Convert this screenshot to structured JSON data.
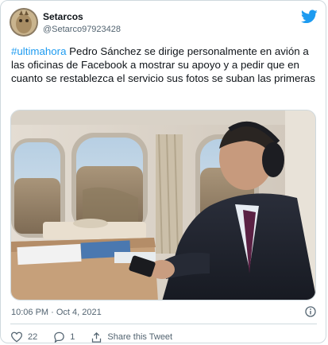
{
  "tweet": {
    "author_name": "Setarcos",
    "author_handle": "@Setarco97923428",
    "hashtag": "#ultimahora",
    "body": " Pedro Sánchez se dirige personalmente en avión a las oficinas de Facebook a mostrar su apoyo y a pedir que en cuanto se restablezca el servicio sus fotos se suban las primeras",
    "timestamp": "10:06 PM · Oct 4, 2021",
    "like_count": "22",
    "reply_count": "1",
    "share_label": "Share this Tweet"
  },
  "icons": {
    "brand": "twitter-bird-icon",
    "info": "info-icon",
    "like": "heart-icon",
    "reply": "reply-bubble-icon",
    "share": "share-upload-icon"
  },
  "colors": {
    "accent": "#1d9bf0",
    "text": "#0f1419",
    "muted": "#536471",
    "border": "#cfd9de"
  }
}
